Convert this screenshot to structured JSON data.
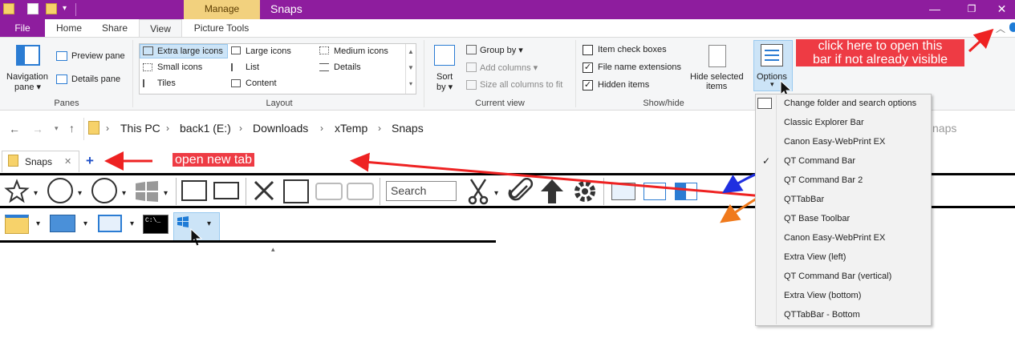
{
  "window": {
    "title": "Snaps",
    "context_tab": "Manage",
    "controls": [
      "—",
      "❐",
      "✕"
    ]
  },
  "ribbon_tabs": {
    "file": "File",
    "home": "Home",
    "share": "Share",
    "view": "View",
    "picture_tools": "Picture Tools"
  },
  "panes": {
    "navigation_pane": "Navigation",
    "navigation_pane_2": "pane ▾",
    "preview_pane": "Preview pane",
    "details_pane": "Details pane",
    "group_label": "Panes"
  },
  "layout": {
    "items": [
      "Extra large icons",
      "Large icons",
      "Medium icons",
      "Small icons",
      "List",
      "Details",
      "Tiles",
      "Content"
    ],
    "group_label": "Layout"
  },
  "current_view": {
    "sort_by": "Sort",
    "sort_by_2": "by ▾",
    "group_by": "Group by ▾",
    "add_columns": "Add columns ▾",
    "size_columns": "Size all columns to fit",
    "group_label": "Current view"
  },
  "show_hide": {
    "item_check_boxes": "Item check boxes",
    "file_name_extensions": "File name extensions",
    "hidden_items": "Hidden items",
    "item_check_boxes_checked": "",
    "file_name_extensions_checked": "✓",
    "hidden_items_checked": "✓",
    "hide_selected": "Hide selected",
    "hide_selected_2": "items",
    "group_label": "Show/hide"
  },
  "options": {
    "label": "Options",
    "caret": "▾"
  },
  "address": {
    "crumbs": [
      "This PC",
      "back1 (E:)",
      "Downloads",
      "xTemp",
      "Snaps"
    ],
    "search_partial": "naps"
  },
  "tabs": {
    "current": "Snaps",
    "close": "✕",
    "new_tab": "+"
  },
  "toolbar": {
    "search_placeholder": "Search"
  },
  "annotations": {
    "open_options": "click here to open this",
    "open_options_2": "bar if not already visible",
    "new_tab": "open new tab"
  },
  "menu": {
    "items": [
      {
        "label": "Change folder and search options",
        "checked": ""
      },
      {
        "label": "Classic Explorer Bar",
        "checked": ""
      },
      {
        "label": "Canon Easy-WebPrint EX",
        "checked": ""
      },
      {
        "label": "QT Command Bar",
        "checked": "✓"
      },
      {
        "label": "QT Command Bar 2",
        "checked": ""
      },
      {
        "label": "QTTabBar",
        "checked": ""
      },
      {
        "label": "QT Base Toolbar",
        "checked": ""
      },
      {
        "label": "Canon Easy-WebPrint EX",
        "checked": ""
      },
      {
        "label": "Extra View (left)",
        "checked": ""
      },
      {
        "label": "QT Command Bar (vertical)",
        "checked": ""
      },
      {
        "label": "Extra View (bottom)",
        "checked": ""
      },
      {
        "label": "QTTabBar - Bottom",
        "checked": ""
      }
    ]
  },
  "colors": {
    "title_purple": "#8e1d9e",
    "manage_tab": "#f2d17e",
    "selection_blue": "#cce4f7",
    "annotation_red": "#ee3b44"
  }
}
